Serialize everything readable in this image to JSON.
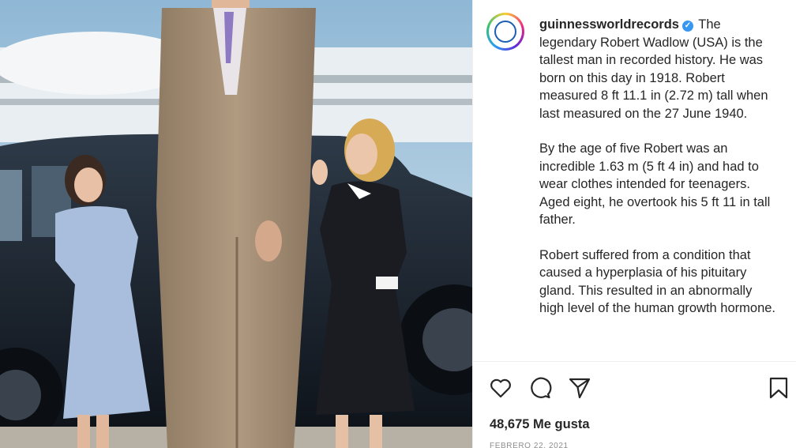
{
  "post": {
    "username": "guinnessworldrecords",
    "verified_icon": "verified-badge-icon",
    "caption_paragraphs": [
      "The legendary Robert Wadlow (USA) is the tallest man in recorded history. He was born on this day in 1918. Robert measured 8 ft 11.1 in (2.72 m) tall when last measured on the 27 June 1940.",
      "By the age of five Robert was an incredible 1.63 m (5 ft 4 in) and had to wear clothes intended for teenagers. Aged eight, he overtook his 5 ft 11 in tall father.",
      "Robert suffered from a condition that caused a hyperplasia of his pituitary gland. This resulted in an abnormally high level of the human growth hormone."
    ],
    "likes_text": "48,675 Me gusta",
    "date_text": "FEBRERO 22, 2021"
  },
  "actions": {
    "like_icon": "heart-icon",
    "comment_icon": "comment-bubble-icon",
    "share_icon": "paper-plane-icon",
    "save_icon": "bookmark-icon"
  },
  "colors": {
    "text": "#262626",
    "muted": "#8e8e8e",
    "verified": "#3897f0",
    "divider": "#efefef"
  }
}
